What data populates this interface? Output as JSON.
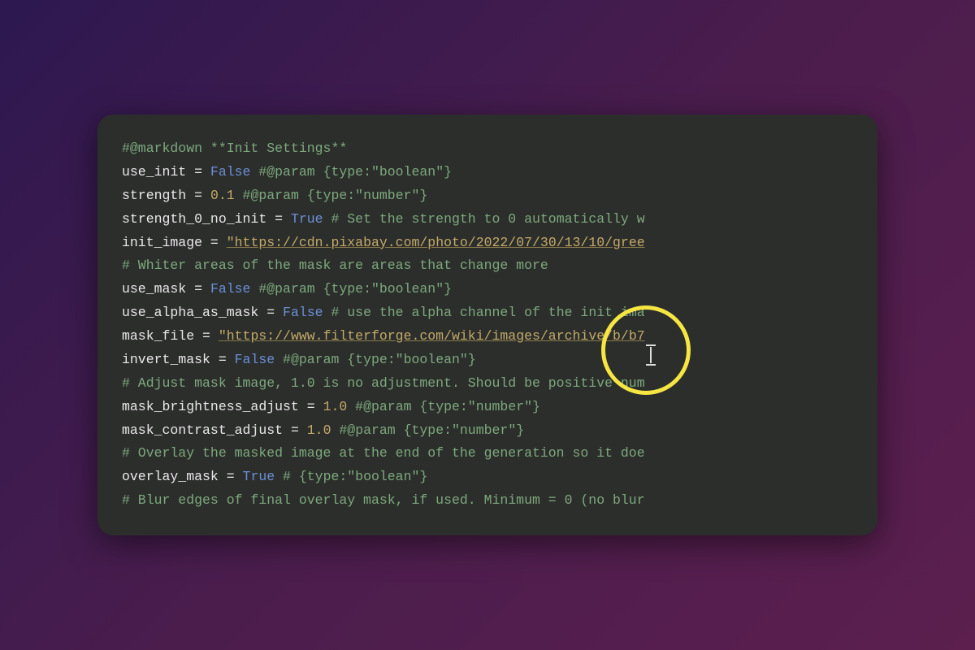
{
  "code": {
    "lines": [
      {
        "type": "comment",
        "text": "#@markdown **Init Settings**"
      },
      {
        "segments": [
          {
            "c": "var",
            "t": "use_init"
          },
          {
            "c": "op",
            "t": " = "
          },
          {
            "c": "bool",
            "t": "False"
          },
          {
            "c": "param",
            "t": " #@param {type:\"boolean\"}"
          }
        ]
      },
      {
        "segments": [
          {
            "c": "var",
            "t": "strength"
          },
          {
            "c": "op",
            "t": " = "
          },
          {
            "c": "num",
            "t": "0.1"
          },
          {
            "c": "param",
            "t": " #@param {type:\"number\"}"
          }
        ]
      },
      {
        "segments": [
          {
            "c": "var",
            "t": "strength_0_no_init"
          },
          {
            "c": "op",
            "t": " = "
          },
          {
            "c": "bool",
            "t": "True"
          },
          {
            "c": "comment",
            "t": " # Set the strength to 0 automatically w"
          }
        ]
      },
      {
        "segments": [
          {
            "c": "var",
            "t": "init_image"
          },
          {
            "c": "op",
            "t": " = "
          },
          {
            "c": "str",
            "t": "\"https://cdn.pixabay.com/photo/2022/07/30/13/10/gree"
          }
        ]
      },
      {
        "type": "comment",
        "text": "# Whiter areas of the mask are areas that change more"
      },
      {
        "segments": [
          {
            "c": "var",
            "t": "use_mask"
          },
          {
            "c": "op",
            "t": " = "
          },
          {
            "c": "bool",
            "t": "False"
          },
          {
            "c": "param",
            "t": " #@param {type:\"boolean\"}"
          }
        ]
      },
      {
        "segments": [
          {
            "c": "var",
            "t": "use_alpha_as_mask"
          },
          {
            "c": "op",
            "t": " = "
          },
          {
            "c": "bool",
            "t": "False"
          },
          {
            "c": "comment",
            "t": " # use the alpha channel of the init ima"
          }
        ]
      },
      {
        "segments": [
          {
            "c": "var",
            "t": "mask_file"
          },
          {
            "c": "op",
            "t": " = "
          },
          {
            "c": "str",
            "t": "\"https://www.filterforge.com/wiki/images/archive/b/b7"
          }
        ]
      },
      {
        "segments": [
          {
            "c": "var",
            "t": "invert_mask"
          },
          {
            "c": "op",
            "t": " = "
          },
          {
            "c": "bool",
            "t": "False"
          },
          {
            "c": "param",
            "t": " #@param {type:\"boolean\"}"
          }
        ]
      },
      {
        "type": "comment",
        "text": "# Adjust mask image, 1.0 is no adjustment. Should be positive num"
      },
      {
        "segments": [
          {
            "c": "var",
            "t": "mask_brightness_adjust"
          },
          {
            "c": "op",
            "t": " = "
          },
          {
            "c": "num",
            "t": "1.0"
          },
          {
            "c": "param",
            "t": "  #@param {type:\"number\"}"
          }
        ]
      },
      {
        "segments": [
          {
            "c": "var",
            "t": "mask_contrast_adjust"
          },
          {
            "c": "op",
            "t": " = "
          },
          {
            "c": "num",
            "t": "1.0"
          },
          {
            "c": "param",
            "t": "  #@param {type:\"number\"}"
          }
        ]
      },
      {
        "type": "comment",
        "text": "# Overlay the masked image at the end of the generation so it doe"
      },
      {
        "segments": [
          {
            "c": "var",
            "t": "overlay_mask"
          },
          {
            "c": "op",
            "t": " = "
          },
          {
            "c": "bool",
            "t": "True"
          },
          {
            "c": "param",
            "t": "  # {type:\"boolean\"}"
          }
        ]
      },
      {
        "type": "comment",
        "text": "# Blur edges of final overlay mask, if used. Minimum = 0 (no blur"
      }
    ]
  }
}
